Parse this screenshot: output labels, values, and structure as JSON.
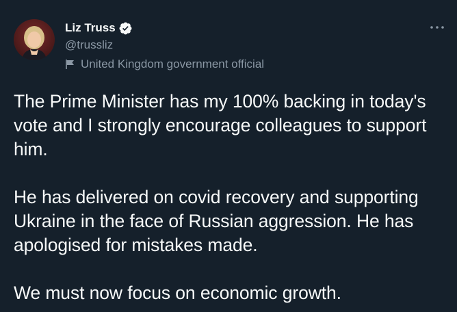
{
  "author": {
    "display_name": "Liz Truss",
    "handle": "@trussliz",
    "label": "United Kingdom government official",
    "avatar_icon": "profile-photo",
    "verified_icon": "verified-badge-icon",
    "label_icon": "flag-icon"
  },
  "menu": {
    "icon": "more-options-icon"
  },
  "tweet": {
    "paragraphs": [
      "The Prime Minister has my 100% backing in today's vote and I strongly encourage colleagues to support him.",
      "He has delivered on covid recovery and supporting Ukraine in the face of Russian aggression. He has apologised for mistakes made.",
      "We must now focus on economic growth."
    ]
  },
  "colors": {
    "background": "#15202b",
    "text": "#f7f9f9",
    "secondary": "#8b98a5",
    "accent": "#1d9bf0"
  }
}
